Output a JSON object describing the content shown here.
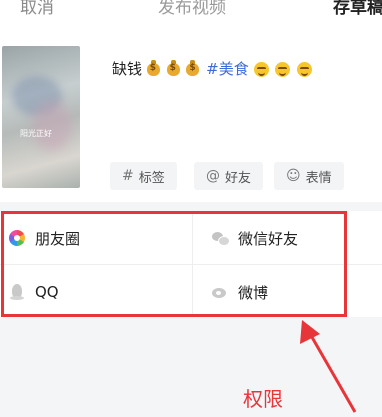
{
  "topbar": {
    "cancel": "取消",
    "title": "发布视频",
    "draft": "存草稿"
  },
  "compose": {
    "thumbnail_caption": "阳光正好",
    "caption_text": "缺钱",
    "caption_tag": "#美食",
    "caption_emoji": [
      "money-bag",
      "money-bag",
      "money-bag",
      "smile",
      "smile",
      "smile"
    ],
    "chips": [
      {
        "icon": "hashtag-icon",
        "glyph": "#",
        "label": "标签"
      },
      {
        "icon": "at-icon",
        "glyph": "@",
        "label": "好友"
      },
      {
        "icon": "emoji-icon",
        "glyph": "☺",
        "label": "表情"
      }
    ]
  },
  "share": {
    "items": [
      {
        "icon": "moments-icon",
        "label": "朋友圈"
      },
      {
        "icon": "wechat-icon",
        "label": "微信好友"
      },
      {
        "icon": "qq-icon",
        "label": "QQ"
      },
      {
        "icon": "weibo-icon",
        "label": "微博"
      }
    ]
  },
  "annotation": {
    "label": "权限",
    "color": "#e8353a"
  },
  "colors": {
    "tag_blue": "#3d6bd6",
    "background": "#f4f5f7"
  }
}
